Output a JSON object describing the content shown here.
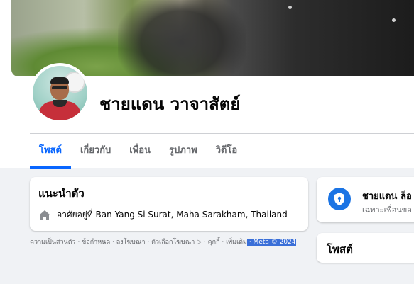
{
  "profile": {
    "name": "ชายแดน วาจาสัตย์"
  },
  "tabs": [
    {
      "label": "โพสต์",
      "active": true
    },
    {
      "label": "เกี่ยวกับ",
      "active": false
    },
    {
      "label": "เพื่อน",
      "active": false
    },
    {
      "label": "รูปภาพ",
      "active": false
    },
    {
      "label": "วิดีโอ",
      "active": false
    }
  ],
  "intro": {
    "title": "แนะนำตัว",
    "lives_in": "อาศัยอยู่ที่ Ban Yang Si Surat, Maha Sarakham, Thailand",
    "icon": "home-icon"
  },
  "footer": {
    "links_text": "ความเป็นส่วนตัว · ข้อกำหนด · ลงโฆษณา · ตัวเลือกโฆษณา ▷ · คุกกี้ · เพิ่มเติม",
    "meta_text": " · Meta © 2024"
  },
  "privacy_card": {
    "name": "ชายแดน ล็อ",
    "subtitle": "เฉพาะเพื่อนขอ",
    "icon": "shield-lock-icon"
  },
  "posts_card": {
    "title": "โพสต์"
  },
  "colors": {
    "accent": "#0866ff",
    "background": "#f0f2f5",
    "shield": "#1b74e4",
    "selection": "#3a6fd8"
  }
}
